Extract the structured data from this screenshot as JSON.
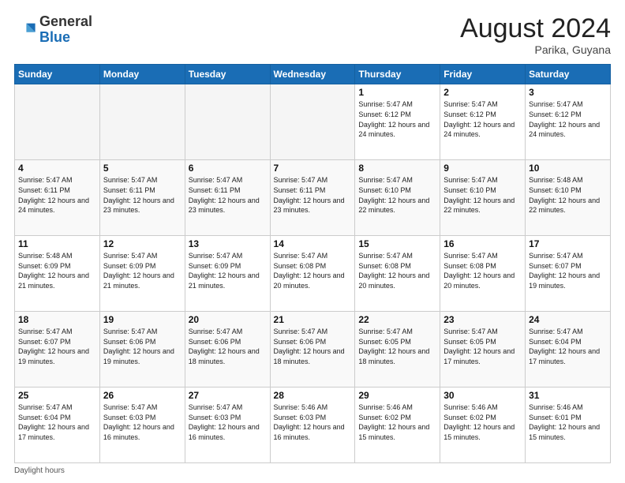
{
  "header": {
    "logo_general": "General",
    "logo_blue": "Blue",
    "month_year": "August 2024",
    "location": "Parika, Guyana"
  },
  "days_of_week": [
    "Sunday",
    "Monday",
    "Tuesday",
    "Wednesday",
    "Thursday",
    "Friday",
    "Saturday"
  ],
  "weeks": [
    [
      {
        "day": "",
        "empty": true
      },
      {
        "day": "",
        "empty": true
      },
      {
        "day": "",
        "empty": true
      },
      {
        "day": "",
        "empty": true
      },
      {
        "day": "1",
        "sunrise": "5:47 AM",
        "sunset": "6:12 PM",
        "daylight": "12 hours and 24 minutes."
      },
      {
        "day": "2",
        "sunrise": "5:47 AM",
        "sunset": "6:12 PM",
        "daylight": "12 hours and 24 minutes."
      },
      {
        "day": "3",
        "sunrise": "5:47 AM",
        "sunset": "6:12 PM",
        "daylight": "12 hours and 24 minutes."
      }
    ],
    [
      {
        "day": "4",
        "sunrise": "5:47 AM",
        "sunset": "6:11 PM",
        "daylight": "12 hours and 24 minutes."
      },
      {
        "day": "5",
        "sunrise": "5:47 AM",
        "sunset": "6:11 PM",
        "daylight": "12 hours and 23 minutes."
      },
      {
        "day": "6",
        "sunrise": "5:47 AM",
        "sunset": "6:11 PM",
        "daylight": "12 hours and 23 minutes."
      },
      {
        "day": "7",
        "sunrise": "5:47 AM",
        "sunset": "6:11 PM",
        "daylight": "12 hours and 23 minutes."
      },
      {
        "day": "8",
        "sunrise": "5:47 AM",
        "sunset": "6:10 PM",
        "daylight": "12 hours and 22 minutes."
      },
      {
        "day": "9",
        "sunrise": "5:47 AM",
        "sunset": "6:10 PM",
        "daylight": "12 hours and 22 minutes."
      },
      {
        "day": "10",
        "sunrise": "5:48 AM",
        "sunset": "6:10 PM",
        "daylight": "12 hours and 22 minutes."
      }
    ],
    [
      {
        "day": "11",
        "sunrise": "5:48 AM",
        "sunset": "6:09 PM",
        "daylight": "12 hours and 21 minutes."
      },
      {
        "day": "12",
        "sunrise": "5:47 AM",
        "sunset": "6:09 PM",
        "daylight": "12 hours and 21 minutes."
      },
      {
        "day": "13",
        "sunrise": "5:47 AM",
        "sunset": "6:09 PM",
        "daylight": "12 hours and 21 minutes."
      },
      {
        "day": "14",
        "sunrise": "5:47 AM",
        "sunset": "6:08 PM",
        "daylight": "12 hours and 20 minutes."
      },
      {
        "day": "15",
        "sunrise": "5:47 AM",
        "sunset": "6:08 PM",
        "daylight": "12 hours and 20 minutes."
      },
      {
        "day": "16",
        "sunrise": "5:47 AM",
        "sunset": "6:08 PM",
        "daylight": "12 hours and 20 minutes."
      },
      {
        "day": "17",
        "sunrise": "5:47 AM",
        "sunset": "6:07 PM",
        "daylight": "12 hours and 19 minutes."
      }
    ],
    [
      {
        "day": "18",
        "sunrise": "5:47 AM",
        "sunset": "6:07 PM",
        "daylight": "12 hours and 19 minutes."
      },
      {
        "day": "19",
        "sunrise": "5:47 AM",
        "sunset": "6:06 PM",
        "daylight": "12 hours and 19 minutes."
      },
      {
        "day": "20",
        "sunrise": "5:47 AM",
        "sunset": "6:06 PM",
        "daylight": "12 hours and 18 minutes."
      },
      {
        "day": "21",
        "sunrise": "5:47 AM",
        "sunset": "6:06 PM",
        "daylight": "12 hours and 18 minutes."
      },
      {
        "day": "22",
        "sunrise": "5:47 AM",
        "sunset": "6:05 PM",
        "daylight": "12 hours and 18 minutes."
      },
      {
        "day": "23",
        "sunrise": "5:47 AM",
        "sunset": "6:05 PM",
        "daylight": "12 hours and 17 minutes."
      },
      {
        "day": "24",
        "sunrise": "5:47 AM",
        "sunset": "6:04 PM",
        "daylight": "12 hours and 17 minutes."
      }
    ],
    [
      {
        "day": "25",
        "sunrise": "5:47 AM",
        "sunset": "6:04 PM",
        "daylight": "12 hours and 17 minutes."
      },
      {
        "day": "26",
        "sunrise": "5:47 AM",
        "sunset": "6:03 PM",
        "daylight": "12 hours and 16 minutes."
      },
      {
        "day": "27",
        "sunrise": "5:47 AM",
        "sunset": "6:03 PM",
        "daylight": "12 hours and 16 minutes."
      },
      {
        "day": "28",
        "sunrise": "5:46 AM",
        "sunset": "6:03 PM",
        "daylight": "12 hours and 16 minutes."
      },
      {
        "day": "29",
        "sunrise": "5:46 AM",
        "sunset": "6:02 PM",
        "daylight": "12 hours and 15 minutes."
      },
      {
        "day": "30",
        "sunrise": "5:46 AM",
        "sunset": "6:02 PM",
        "daylight": "12 hours and 15 minutes."
      },
      {
        "day": "31",
        "sunrise": "5:46 AM",
        "sunset": "6:01 PM",
        "daylight": "12 hours and 15 minutes."
      }
    ]
  ],
  "footer": {
    "note": "Daylight hours"
  }
}
